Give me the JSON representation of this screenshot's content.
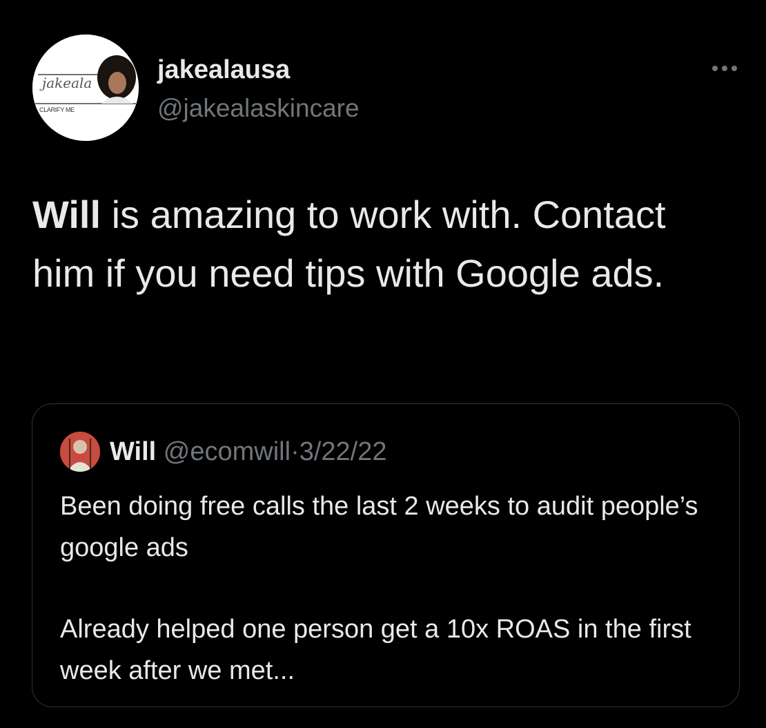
{
  "author": {
    "display_name": "jakealausa",
    "handle": "@jakealaskincare",
    "avatar_text": {
      "script": "jakeala",
      "banner": "CLARIFY ME"
    }
  },
  "tweet": {
    "text_bold": "Will",
    "text_rest": " is amazing to work with. Contact him if you need tips with Google ads."
  },
  "quoted": {
    "display_name": "Will",
    "handle": "@ecomwill",
    "separator": "·",
    "date": "3/22/22",
    "paragraph_1": "Been doing free calls the last 2 weeks to audit people’s google ads",
    "paragraph_2": "Already helped one person get a 10x ROAS in the first week after we met..."
  },
  "icons": {
    "more": "more-horizontal-icon"
  },
  "colors": {
    "background": "#000000",
    "primary_text": "#e7e9ea",
    "secondary_text": "#71767b",
    "border": "#2f3336"
  }
}
